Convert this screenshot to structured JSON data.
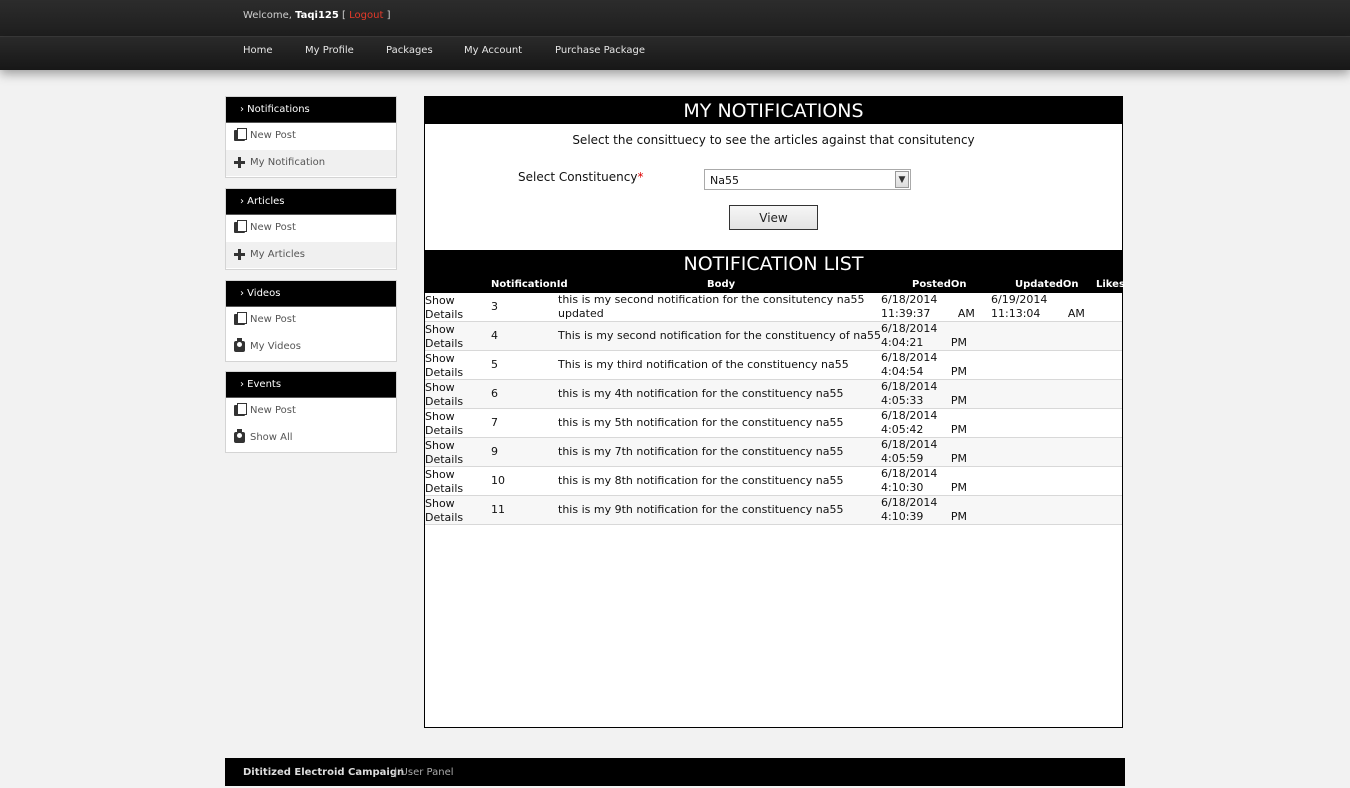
{
  "header": {
    "welcome_prefix": "Welcome,",
    "username": "Taqi125",
    "bracket_open": "[",
    "logout_label": "Logout",
    "bracket_close": "]"
  },
  "nav": {
    "home": "Home",
    "my_profile": "My Profile",
    "packages": "Packages",
    "my_account": "My Account",
    "purchase_package": "Purchase Package"
  },
  "sidebar": {
    "notifications": {
      "title": "› Notifications",
      "items": [
        {
          "label": "New Post",
          "icon": "document-icon"
        },
        {
          "label": "My Notification",
          "icon": "plus-icon"
        }
      ]
    },
    "articles": {
      "title": "› Articles",
      "items": [
        {
          "label": "New Post",
          "icon": "document-icon"
        },
        {
          "label": "My Articles",
          "icon": "plus-icon"
        }
      ]
    },
    "videos": {
      "title": "› Videos",
      "items": [
        {
          "label": "New Post",
          "icon": "document-icon"
        },
        {
          "label": "My Videos",
          "icon": "camera-icon"
        }
      ]
    },
    "events": {
      "title": "› Events",
      "items": [
        {
          "label": "New Post",
          "icon": "document-icon"
        },
        {
          "label": "Show All",
          "icon": "camera-icon"
        }
      ]
    }
  },
  "main": {
    "title": "MY NOTIFICATIONS",
    "instruction": "Select the consittuecy to see the articles against that consitutency",
    "select_label": "Select Constituency",
    "required_mark": "*",
    "select_value": "Na55",
    "view_button": "View",
    "list_title": "NOTIFICATION LIST"
  },
  "grid": {
    "columns": {
      "id": "NotificationId",
      "body": "Body",
      "posted": "PostedOn",
      "updated": "UpdatedOn",
      "likes": "Likes"
    },
    "show_label": "Show Details",
    "rows": [
      {
        "id": "3",
        "body": "this is my second notification for the consitutency na55 updated",
        "posted": "6/18/2014 11:39:37 AM",
        "updated": "6/19/2014 11:13:04 AM"
      },
      {
        "id": "4",
        "body": "This is my second notification for the constituency of na55",
        "posted": "6/18/2014 4:04:21 PM",
        "updated": ""
      },
      {
        "id": "5",
        "body": "This is my third notification of the constituency na55",
        "posted": "6/18/2014 4:04:54 PM",
        "updated": ""
      },
      {
        "id": "6",
        "body": "this is my 4th notification for the constituency na55",
        "posted": "6/18/2014 4:05:33 PM",
        "updated": ""
      },
      {
        "id": "7",
        "body": "this is my 5th notification for the constituency na55",
        "posted": "6/18/2014 4:05:42 PM",
        "updated": ""
      },
      {
        "id": "9",
        "body": "this is my 7th notification for the constituency na55",
        "posted": "6/18/2014 4:05:59 PM",
        "updated": ""
      },
      {
        "id": "10",
        "body": "this is my 8th notification for the constituency na55",
        "posted": "6/18/2014 4:10:30 PM",
        "updated": ""
      },
      {
        "id": "11",
        "body": "this is my 9th notification for the constituency na55",
        "posted": "6/18/2014 4:10:39 PM",
        "updated": ""
      }
    ]
  },
  "footer": {
    "brand": "Dititized Electroid Campaign",
    "separator_sub": "| User Panel"
  }
}
